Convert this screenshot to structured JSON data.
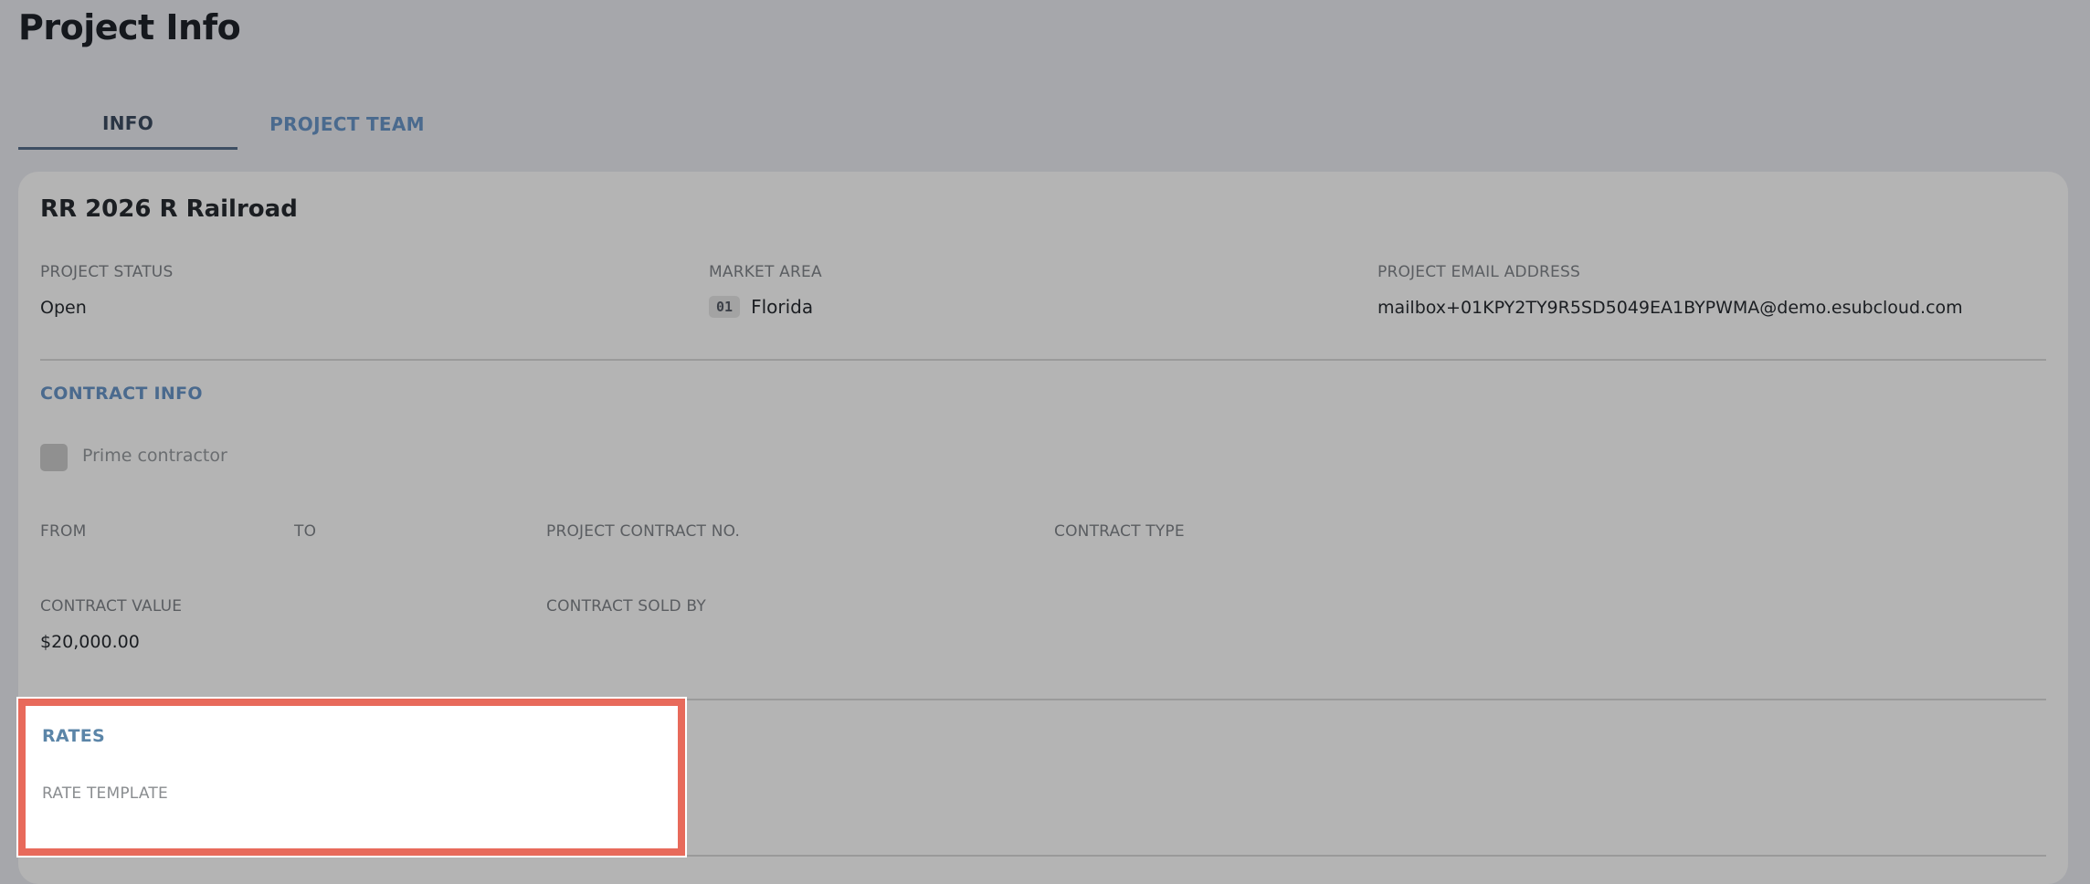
{
  "header": {
    "title": "Project Info"
  },
  "tabs": [
    {
      "label": "INFO",
      "active": true
    },
    {
      "label": "PROJECT TEAM",
      "active": false
    }
  ],
  "project": {
    "name": "RR 2026 R Railroad",
    "status_label": "PROJECT STATUS",
    "status_value": "Open",
    "market_area_label": "MARKET AREA",
    "market_area_code": "01",
    "market_area_name": "Florida",
    "email_label": "PROJECT EMAIL ADDRESS",
    "email_value": "mailbox+01KPY2TY9R5SD5049EA1BYPWMA@demo.esubcloud.com"
  },
  "contract": {
    "section_title": "CONTRACT INFO",
    "prime_contractor_label": "Prime contractor",
    "prime_contractor_checked": false,
    "from_label": "FROM",
    "to_label": "TO",
    "contract_no_label": "PROJECT CONTRACT NO.",
    "contract_type_label": "CONTRACT TYPE",
    "contract_value_label": "CONTRACT VALUE",
    "contract_value": "$20,000.00",
    "sold_by_label": "CONTRACT SOLD BY"
  },
  "rates": {
    "section_title": "RATES",
    "rate_template_label": "RATE TEMPLATE"
  },
  "colors": {
    "highlight_border": "#e86a5b",
    "accent_blue": "#4a6a8e",
    "page_overlay": "#a6a7ab"
  }
}
